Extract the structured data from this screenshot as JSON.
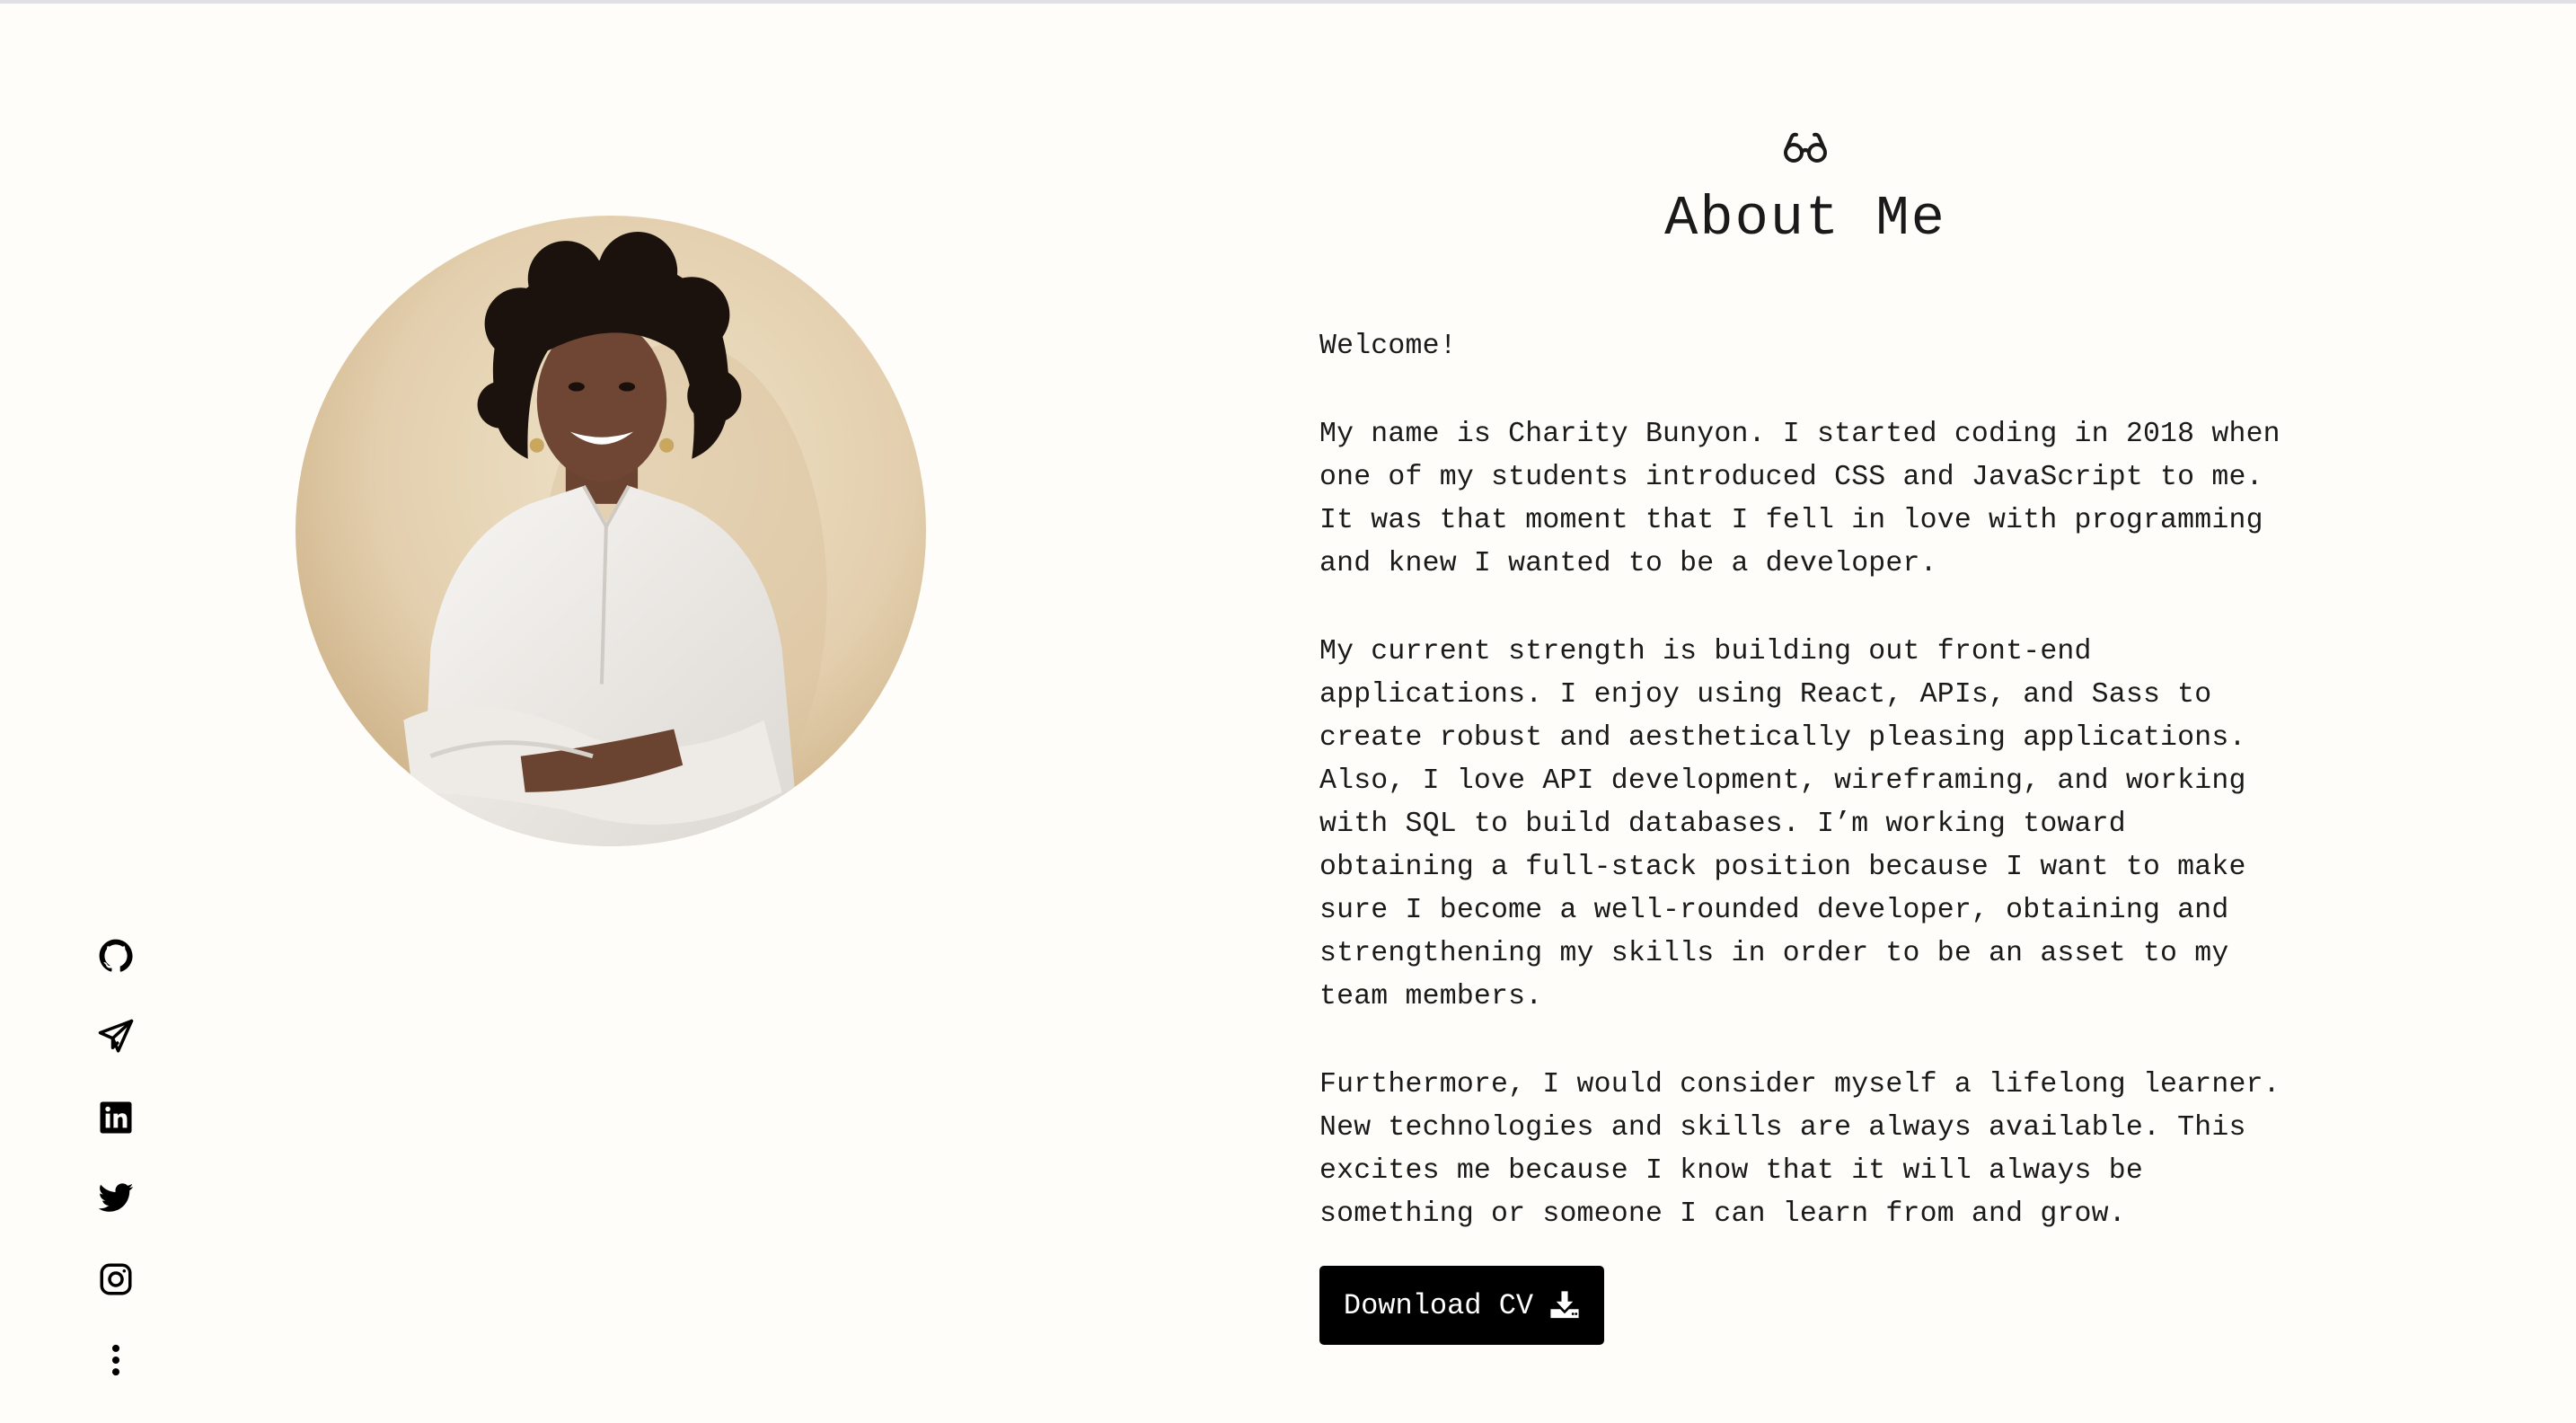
{
  "about": {
    "icon": "glasses-icon",
    "title": "About Me",
    "paragraphs": [
      "Welcome!",
      "My name is Charity Bunyon. I started coding in 2018 when\none of my students introduced CSS and JavaScript to me.\nIt was that moment that I fell in love with programming\nand knew I wanted to be a developer.",
      "My current strength is building out front-end\napplications. I enjoy using React, APIs, and Sass to\ncreate robust and aesthetically pleasing applications.\nAlso, I love API development, wireframing, and working\nwith SQL to build databases. I’m working toward\nobtaining a full-stack position because I want to make\nsure I become a well-rounded developer, obtaining and\nstrengthening my skills in order to be an asset to my\nteam members.",
      "Furthermore, I would consider myself a lifelong learner.\nNew technologies and skills are always available. This\nexcites me because I know that it will always be\nsomething or someone I can learn from and grow."
    ],
    "download_button": {
      "label": "Download CV",
      "icon": "download-icon"
    }
  },
  "social_links": [
    {
      "name": "github",
      "icon": "github-icon"
    },
    {
      "name": "telegram",
      "icon": "paper-plane-icon"
    },
    {
      "name": "linkedin",
      "icon": "linkedin-icon"
    },
    {
      "name": "twitter",
      "icon": "twitter-icon"
    },
    {
      "name": "instagram",
      "icon": "instagram-icon"
    },
    {
      "name": "more",
      "icon": "more-vertical-icon"
    }
  ],
  "colors": {
    "background": "#fefdf9",
    "text": "#1a1a1a",
    "button": "#000000",
    "button_text": "#ffffff"
  }
}
